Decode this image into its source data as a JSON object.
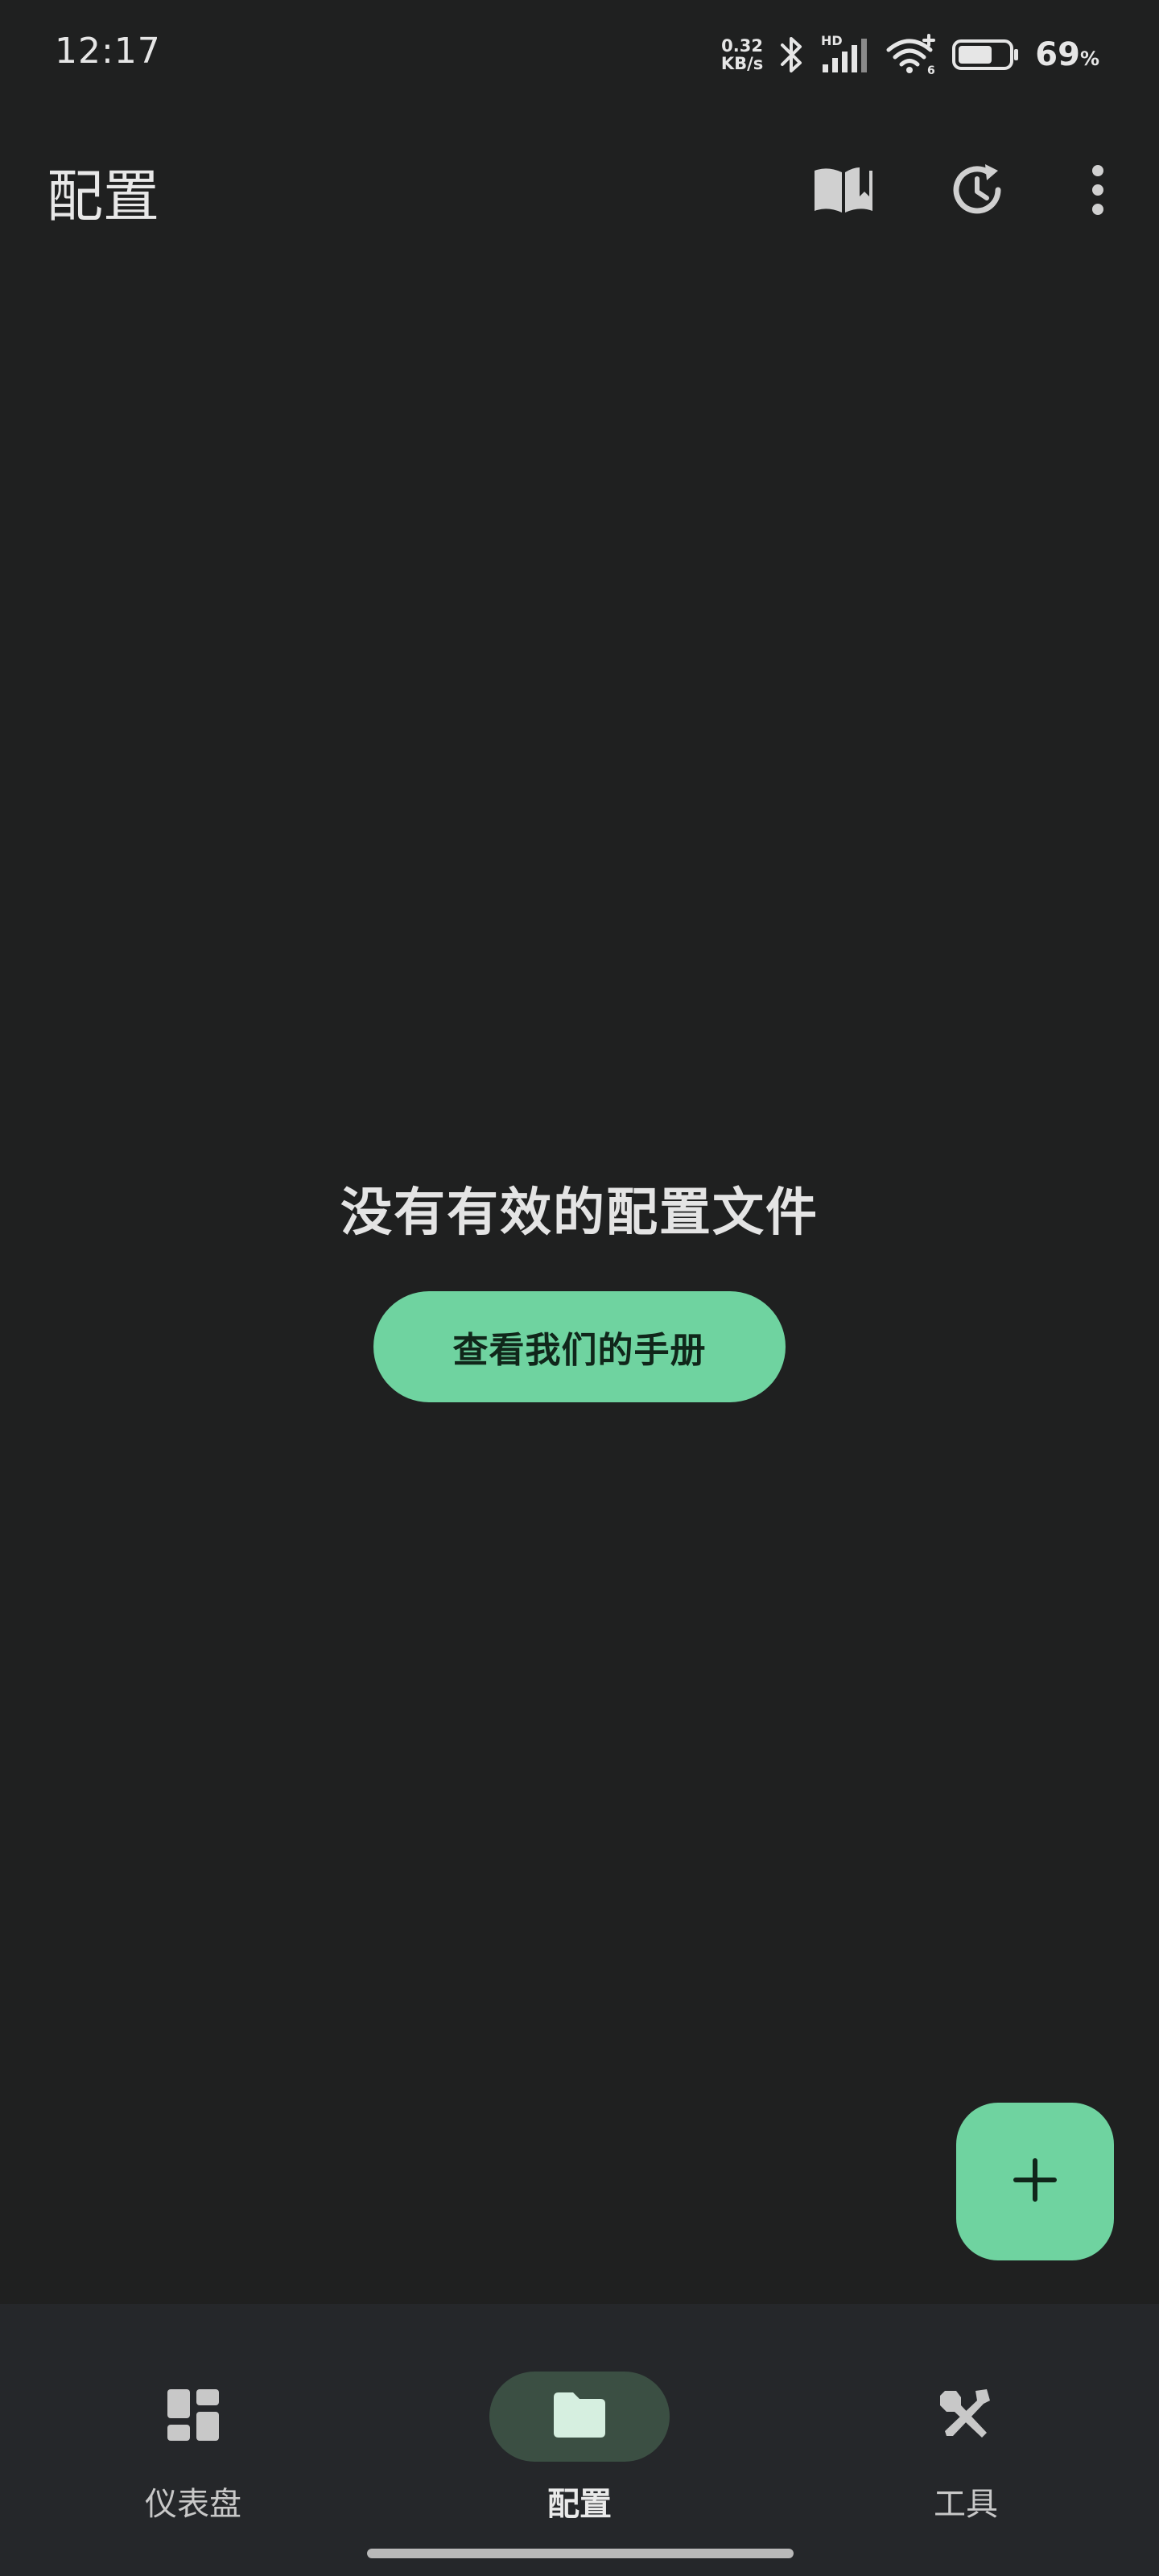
{
  "status_bar": {
    "time": "12:17",
    "net_speed_value": "0.32",
    "net_speed_unit": "KB/s",
    "signal_badge": "HD",
    "wifi_badge": "6",
    "battery_level": 0.69,
    "battery_value": "69",
    "battery_unit": "%"
  },
  "app_bar": {
    "title": "配置",
    "actions": [
      {
        "name": "manual",
        "icon": "book-open-icon"
      },
      {
        "name": "history",
        "icon": "history-icon"
      },
      {
        "name": "more",
        "icon": "more-vert-icon"
      }
    ]
  },
  "empty_state": {
    "title": "没有有效的配置文件",
    "button_label": "查看我们的手册"
  },
  "fab": {
    "icon": "plus-icon"
  },
  "bottom_nav": {
    "items": [
      {
        "label": "仪表盘",
        "icon": "dashboard-icon",
        "active": false
      },
      {
        "label": "配置",
        "icon": "folder-icon",
        "active": true
      },
      {
        "label": "工具",
        "icon": "tools-icon",
        "active": false
      }
    ]
  },
  "colors": {
    "background": "#1f2020",
    "accent": "#6fd3a0",
    "nav_background": "#25272a",
    "nav_active_pill": "#3b4f43"
  }
}
